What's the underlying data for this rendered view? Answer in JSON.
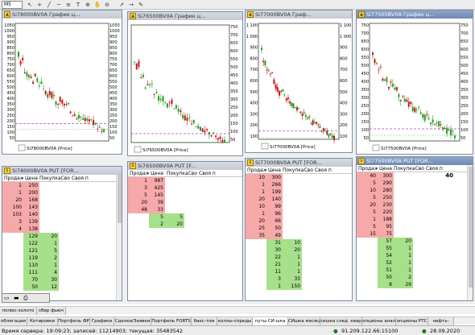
{
  "toolbar": {
    "timeframe": "M5"
  },
  "charts": [
    {
      "title": "Si78000BV0A График ц...",
      "caption": "Si78000BV0A [Price]",
      "axis_left": [
        "1050",
        "1000",
        "950",
        "900",
        "850",
        "800",
        "750",
        "700",
        "650",
        "600",
        "550",
        "500",
        "450",
        "400",
        "350",
        "300",
        "250",
        "200",
        "150",
        "100",
        "50"
      ],
      "axis_right": [
        "1050",
        "1000",
        "950",
        "900",
        "850",
        "800",
        "750",
        "700",
        "650",
        "600",
        "550",
        "500",
        "450",
        "400",
        "350",
        "300",
        "250",
        "200",
        "150",
        "100",
        "50"
      ],
      "last_price": 138,
      "level_price": 190
    },
    {
      "title": "Si76500BV0A График ц...",
      "caption": "Si76500BV0A [Price]",
      "axis_left": [],
      "axis_right": [
        "750",
        "700",
        "650",
        "600",
        "550",
        "500",
        "450",
        "400",
        "350",
        "300",
        "250",
        "200",
        "150",
        "100",
        "50"
      ],
      "last_price": 42,
      "level_price": 95
    },
    {
      "title": "Si77000BV0A Граф...",
      "caption": "Si77000BV0A [Price]",
      "axis_left": [
        "1 100",
        "1 000",
        "900",
        "800",
        "700",
        "600",
        "500",
        "400",
        "300",
        "200",
        "100"
      ],
      "axis_right": [
        "1 100",
        "1 000",
        "900",
        "800",
        "700",
        "600",
        "500",
        "400",
        "300",
        "200",
        "100"
      ],
      "last_price": 99,
      "level_price": 160
    },
    {
      "title": "Si77500BV0A График ц...",
      "caption": "Si77500BV0A [Price]",
      "axis_left": [
        "750",
        "700",
        "650",
        "600",
        "550",
        "500",
        "450",
        "400",
        "350",
        "300",
        "250",
        "200",
        "150",
        "100",
        "50"
      ],
      "axis_right": [
        "750",
        "700",
        "650",
        "600",
        "550",
        "500",
        "450",
        "400",
        "350",
        "300",
        "250",
        "200",
        "150",
        "100",
        "50"
      ],
      "last_price": 75,
      "level_price": 115
    }
  ],
  "books": [
    {
      "title": "Si78000BV0A PUT [FOR...",
      "headers": [
        "Продаж",
        "Цена",
        "ПокупкаСвоя п",
        "Своя п"
      ],
      "sell": [
        [
          "1",
          "250"
        ],
        [
          "1",
          "200"
        ],
        [
          "20",
          "168"
        ],
        [
          "100",
          "143"
        ],
        [
          "103",
          "140"
        ],
        [
          "3",
          "139"
        ],
        [
          "4",
          "138"
        ]
      ],
      "buy": [
        [
          "129",
          "20"
        ],
        [
          "122",
          "1"
        ],
        [
          "121",
          "5"
        ],
        [
          "119",
          "2"
        ],
        [
          "110",
          "1"
        ],
        [
          "111",
          "4"
        ],
        [
          "70",
          "30"
        ],
        [
          "50",
          "12"
        ]
      ]
    },
    {
      "title": "Si76500BV0A PUT [F...",
      "headers": [
        "Продаж",
        "Цена",
        "ПокупкаСвоя п",
        "Своя п"
      ],
      "sell": [
        [
          "1",
          "987"
        ],
        [
          "3",
          "425"
        ],
        [
          "5",
          "145"
        ],
        [
          "20",
          "39"
        ],
        [
          "48",
          "33"
        ]
      ],
      "buy": [
        [
          "5",
          "5"
        ],
        [
          "2",
          "20"
        ]
      ]
    },
    {
      "title": "Si77000BV0A PUT [FOR...",
      "headers": [
        "Продаж",
        "Цена",
        "ПокупкаСвоя п",
        "Своя п"
      ],
      "sell": [
        [
          "10",
          "300"
        ],
        [
          "1",
          "266"
        ],
        [
          "1",
          "199"
        ],
        [
          "20",
          "140"
        ],
        [
          "10",
          "99"
        ],
        [
          "1",
          "96"
        ],
        [
          "20",
          "66"
        ],
        [
          "25",
          "50"
        ],
        [
          "35",
          "49"
        ]
      ],
      "buy": [
        [
          "31",
          "10"
        ],
        [
          "30",
          "20"
        ],
        [
          "22",
          "1"
        ],
        [
          "21",
          "1"
        ],
        [
          "11",
          "1"
        ],
        [
          "3",
          "33"
        ],
        [
          "1",
          "150"
        ]
      ]
    },
    {
      "title": "Si77500BV0A PUT [FOR...",
      "headers": [
        "Продаж",
        "Цена",
        "ПокупкаСвоя п",
        "Своя п"
      ],
      "own": "40",
      "sell": [
        [
          "40",
          "300"
        ],
        [
          "5",
          "290"
        ],
        [
          "10",
          "280"
        ],
        [
          "5",
          "250"
        ],
        [
          "20",
          "230"
        ],
        [
          "5",
          "220"
        ],
        [
          "1",
          "188"
        ],
        [
          "5",
          "95"
        ],
        [
          "15",
          "75"
        ]
      ],
      "buy": [
        [
          "57",
          "20"
        ],
        [
          "55",
          "1"
        ],
        [
          "54",
          "1"
        ],
        [
          "52",
          "1"
        ],
        [
          "51",
          "1"
        ],
        [
          "50",
          "2"
        ],
        [
          "8",
          "29"
        ]
      ]
    }
  ],
  "sheet_tabs_row1": [
    "полюс-золото",
    "сбер фьюч"
  ],
  "sheet_tabs_row2": [
    "облигации",
    "Котировки",
    "Портфель ФР",
    "Графики",
    "Сделки/Заявки",
    "Портфель FORTS",
    "бакс-том",
    "коллы-спреды",
    "путы СИ-шка",
    "СИшка месяц",
    "сишка след. квартал",
    "опционы анализ",
    "опционы РТС",
    "нефть-"
  ],
  "status": {
    "left": "Время сервера: 19:09:23; записей: 11214903; текущая: 35483542",
    "server": "91.209.122.66:15100",
    "date": "28.09.2020"
  },
  "colors": {
    "sell": "#f7a9a9",
    "buy": "#a6e08a",
    "candle_up": "#1fa01f",
    "candle_down": "#c01818",
    "level": "#b040c0"
  }
}
